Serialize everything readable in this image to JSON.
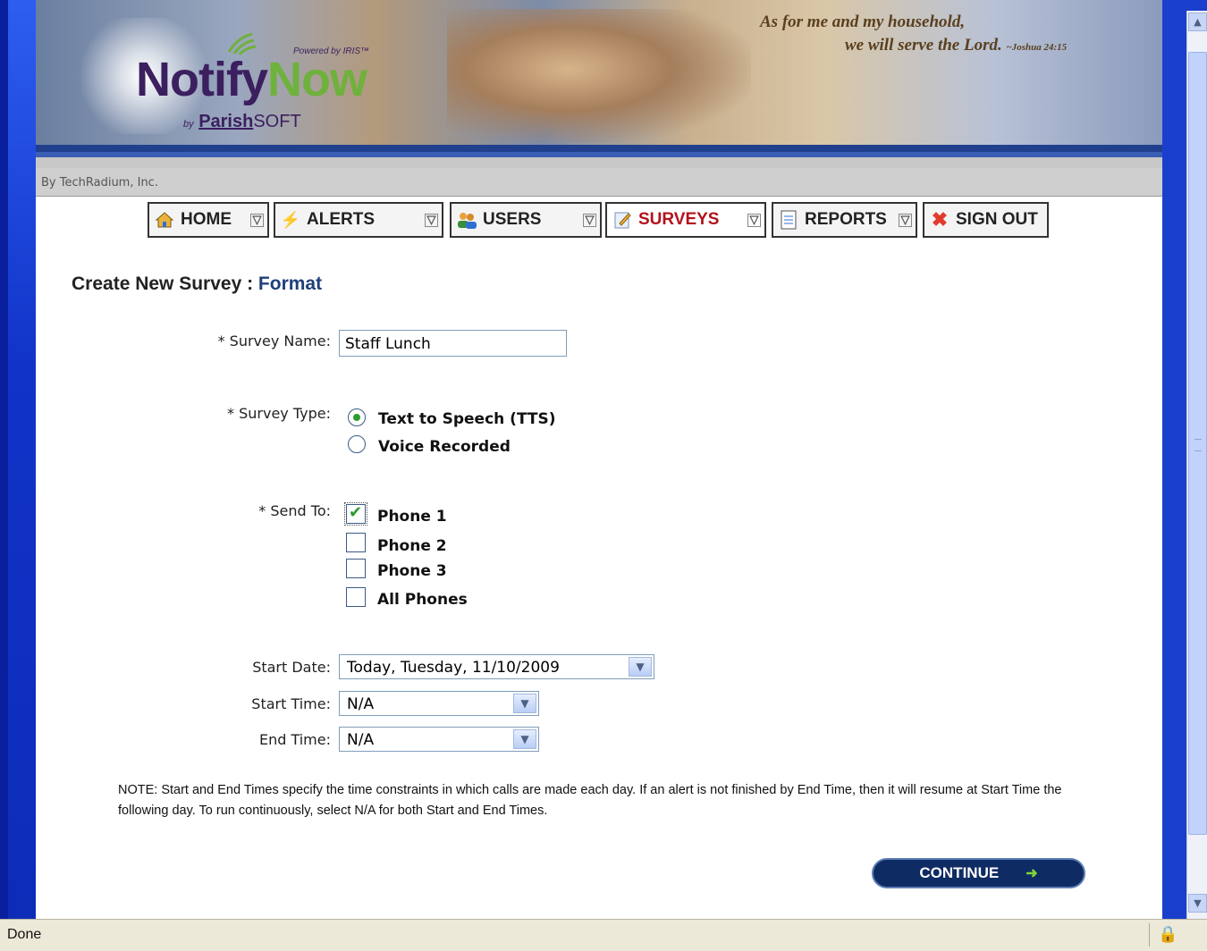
{
  "banner": {
    "logo_part1": "Notify",
    "logo_part2": "Now",
    "powered_by": "Powered by IRIS™",
    "by_prefix": "by",
    "by_brand_a": "Parish",
    "by_brand_b": "SOFT",
    "verse_line1": "As for me and my household,",
    "verse_line2": "we will serve the Lord.",
    "verse_ref": "~Joshua 24:15"
  },
  "byline": "By TechRadium, Inc.",
  "nav": [
    {
      "label": "HOME",
      "icon": "home-icon"
    },
    {
      "label": "ALERTS",
      "icon": "lightning-icon"
    },
    {
      "label": "USERS",
      "icon": "users-icon"
    },
    {
      "label": "SURVEYS",
      "icon": "survey-icon"
    },
    {
      "label": "REPORTS",
      "icon": "reports-icon"
    },
    {
      "label": "SIGN OUT",
      "icon": "close-icon"
    }
  ],
  "page_title": {
    "main": "Create New Survey :",
    "accent": " Format"
  },
  "form": {
    "survey_name_label": "* Survey Name:",
    "survey_name_value": "Staff Lunch",
    "survey_type_label": "* Survey Type:",
    "survey_type_options": [
      "Text to Speech (TTS)",
      "Voice Recorded"
    ],
    "survey_type_selected": "Text to Speech (TTS)",
    "send_to_label": "* Send To:",
    "send_to_options": [
      "Phone 1",
      "Phone 2",
      "Phone 3",
      "All Phones"
    ],
    "send_to_checked": [
      "Phone 1"
    ],
    "start_date_label": "Start Date:",
    "start_date_value": "Today, Tuesday, 11/10/2009",
    "start_time_label": "Start Time:",
    "start_time_value": "N/A",
    "end_time_label": "End Time:",
    "end_time_value": "N/A"
  },
  "note": "NOTE: Start and End Times specify the time constraints in which calls are made each day. If an alert is not finished by End Time, then it will resume at Start Time the following day. To run continuously, select N/A for both Start and End Times.",
  "continue_label": "CONTINUE",
  "status_text": "Done",
  "colors": {
    "accent": "#1e3f7a",
    "active_nav": "#b3121b",
    "button": "#0f2b63"
  }
}
